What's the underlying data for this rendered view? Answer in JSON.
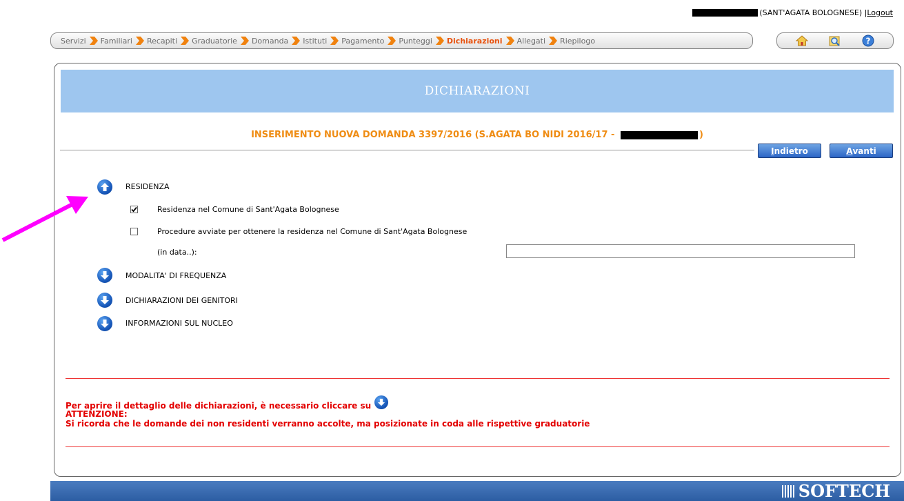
{
  "user": {
    "comune": "(SANT'AGATA BOLOGNESE) | ",
    "logout": "Logout"
  },
  "steps": [
    {
      "label": "Servizi"
    },
    {
      "label": "Familiari"
    },
    {
      "label": "Recapiti"
    },
    {
      "label": "Graduatorie"
    },
    {
      "label": "Domanda"
    },
    {
      "label": "Istituti"
    },
    {
      "label": "Pagamento"
    },
    {
      "label": "Punteggi"
    },
    {
      "label": "Dichiarazioni",
      "active": true
    },
    {
      "label": "Allegati"
    },
    {
      "label": "Riepilogo"
    }
  ],
  "toolbar_icons": [
    "home-icon",
    "search-folder-icon",
    "help-icon"
  ],
  "header": {
    "title": "DICHIARAZIONI"
  },
  "subtitle": {
    "prefix": "INSERIMENTO NUOVA DOMANDA 3397/2016 (S.AGATA BO NIDI 2016/17 - ",
    "suffix": ")"
  },
  "buttons": {
    "back_u": "I",
    "back_rest": "ndietro",
    "next_u": "A",
    "next_rest": "vanti"
  },
  "sections": {
    "residenza": {
      "label": "RESIDENZA",
      "expanded": true,
      "options": [
        {
          "label": "Residenza nel Comune di Sant'Agata Bolognese",
          "checked": true
        },
        {
          "label": "Procedure avviate per ottenere la residenza nel Comune di Sant'Agata Bolognese",
          "checked": false
        }
      ],
      "date_label": "(in data..):",
      "date_value": ""
    },
    "modalita": {
      "label": "MODALITA' DI FREQUENZA"
    },
    "genitori": {
      "label": "DICHIARAZIONI DEI GENITORI"
    },
    "nucleo": {
      "label": "INFORMAZIONI SUL NUCLEO"
    }
  },
  "notes": {
    "open_detail": "Per aprire il dettaglio delle dichiarazioni, è necessario cliccare su",
    "attention": "ATTENZIONE:",
    "reminder": "Si ricorda che le domande dei non residenti verranno accolte, ma posizionate in coda alle rispettive graduatorie"
  },
  "footer": {
    "brand": "SOFTECH"
  },
  "colors": {
    "accent_orange": "#e8520e",
    "header_blue": "#9ec6ef",
    "button_blue": "#2c65c6",
    "warning_red": "#e30000",
    "annotation_magenta": "#ff00ff"
  }
}
